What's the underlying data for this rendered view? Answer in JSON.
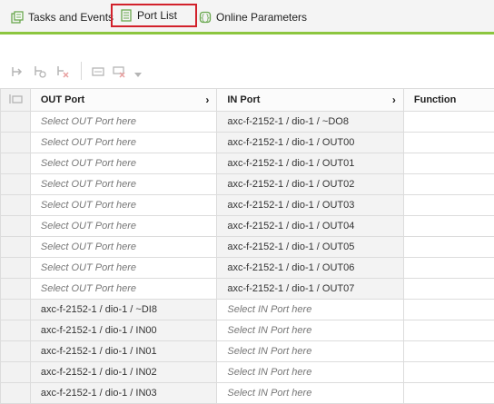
{
  "tabs": [
    {
      "label": "Tasks and Events",
      "icon": "tasks-events-icon",
      "active": false
    },
    {
      "label": "Port List",
      "icon": "port-list-icon",
      "active": true
    },
    {
      "label": "Online Parameters",
      "icon": "online-parameters-icon",
      "active": false
    }
  ],
  "colors": {
    "accent": "#8cc63f",
    "active_outline": "#d2212b",
    "icon_green": "#6aa84f"
  },
  "toolbar": {
    "icons": [
      "connect-port-icon",
      "auto-connect-icon",
      "disconnect-icon",
      "group-icon",
      "remove-group-icon",
      "dropdown-arrow-icon"
    ]
  },
  "table": {
    "columns": [
      "OUT Port",
      "IN Port",
      "Function"
    ],
    "rows": [
      {
        "out": "Select OUT Port here",
        "in": "axc-f-2152-1 / dio-1 / ~DO8",
        "out_placeholder": true
      },
      {
        "out": "Select OUT Port here",
        "in": "axc-f-2152-1 / dio-1 / OUT00",
        "out_placeholder": true
      },
      {
        "out": "Select OUT Port here",
        "in": "axc-f-2152-1 / dio-1 / OUT01",
        "out_placeholder": true
      },
      {
        "out": "Select OUT Port here",
        "in": "axc-f-2152-1 / dio-1 / OUT02",
        "out_placeholder": true
      },
      {
        "out": "Select OUT Port here",
        "in": "axc-f-2152-1 / dio-1 / OUT03",
        "out_placeholder": true
      },
      {
        "out": "Select OUT Port here",
        "in": "axc-f-2152-1 / dio-1 / OUT04",
        "out_placeholder": true
      },
      {
        "out": "Select OUT Port here",
        "in": "axc-f-2152-1 / dio-1 / OUT05",
        "out_placeholder": true
      },
      {
        "out": "Select OUT Port here",
        "in": "axc-f-2152-1 / dio-1 / OUT06",
        "out_placeholder": true
      },
      {
        "out": "Select OUT Port here",
        "in": "axc-f-2152-1 / dio-1 / OUT07",
        "out_placeholder": true
      },
      {
        "out": "axc-f-2152-1 / dio-1 / ~DI8",
        "in": "Select IN Port here",
        "out_placeholder": false
      },
      {
        "out": "axc-f-2152-1 / dio-1 / IN00",
        "in": "Select IN Port here",
        "out_placeholder": false
      },
      {
        "out": "axc-f-2152-1 / dio-1 / IN01",
        "in": "Select IN Port here",
        "out_placeholder": false
      },
      {
        "out": "axc-f-2152-1 / dio-1 / IN02",
        "in": "Select IN Port here",
        "out_placeholder": false
      },
      {
        "out": "axc-f-2152-1 / dio-1 / IN03",
        "in": "Select IN Port here",
        "out_placeholder": false
      }
    ]
  }
}
